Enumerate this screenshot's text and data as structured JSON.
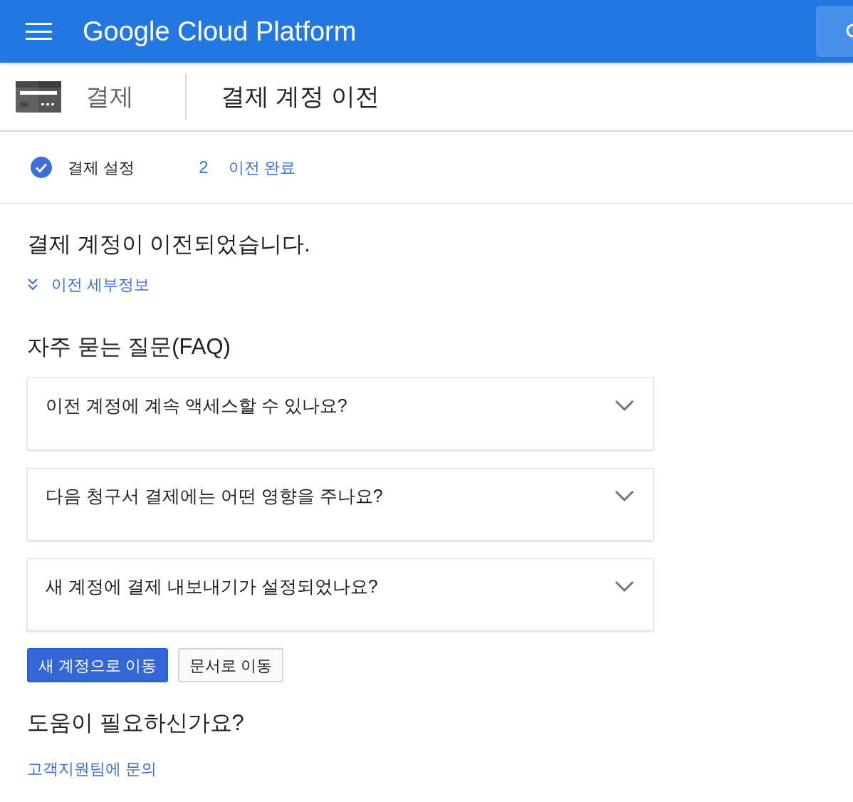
{
  "app_bar": {
    "title": "Google Cloud Platform"
  },
  "header": {
    "section": "결제",
    "page_title": "결제 계정 이전"
  },
  "steps": [
    {
      "label": "결제 설정",
      "completed": true
    },
    {
      "number": "2",
      "label": "이전 완료",
      "completed": false
    }
  ],
  "result": {
    "heading": "결제 계정이 이전되었습니다.",
    "details_link": "이전 세부정보",
    "details_expanded": false
  },
  "faq": {
    "heading": "자주 묻는 질문(FAQ)",
    "items": [
      {
        "question": "이전 계정에 계속 액세스할 수 있나요?",
        "expanded": false
      },
      {
        "question": "다음 청구서 결제에는 어떤 영향을 주나요?",
        "expanded": false
      },
      {
        "question": "새 계정에 결제 내보내기가 설정되었나요?",
        "expanded": false
      }
    ]
  },
  "buttons": [
    {
      "label": "새 계정으로 이동",
      "kind": "primary"
    },
    {
      "label": "문서로 이동",
      "kind": "secondary"
    }
  ],
  "help": {
    "heading": "도움이 필요하신가요?",
    "link": "고객지원팀에 문의"
  }
}
